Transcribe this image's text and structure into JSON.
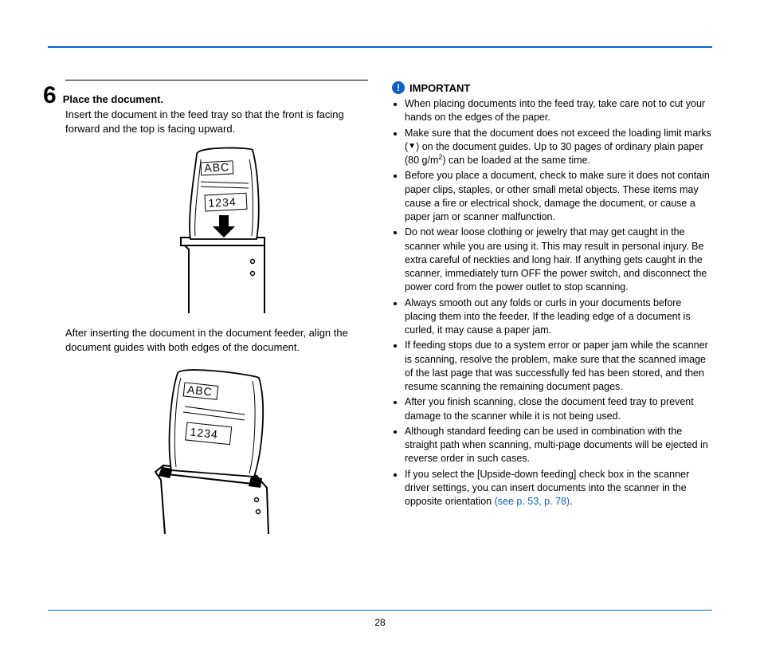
{
  "page_number": "28",
  "step": {
    "number": "6",
    "heading": "Place the document.",
    "body": "Insert the document in the feed tray so that the front is facing forward and the top is facing upward.",
    "caption2": "After inserting the document in the document feeder, align the document guides with both edges of the document."
  },
  "illus_text": {
    "abc": "ABC",
    "num": "1234"
  },
  "important": {
    "label": "IMPORTANT",
    "items": [
      "When placing documents into the feed tray, take care not to cut your hands on the edges of the paper.",
      "Make sure that the document does not exceed the loading limit marks (▼) on the document guides. Up to 30 pages of ordinary plain paper (80 g/m²) can be loaded at the same time.",
      "Before you place a document, check to make sure it does not contain paper clips, staples, or other small metal objects. These items may cause a fire or electrical shock, damage the document, or cause a paper jam or scanner malfunction.",
      "Do not wear loose clothing or jewelry that may get caught in the scanner while you are using it. This may result in personal injury. Be extra careful of neckties and long hair. If anything gets caught in the scanner, immediately turn OFF the power switch, and disconnect the power cord from the power outlet to stop scanning.",
      "Always smooth out any folds or curls in your documents before placing them into the feeder. If the leading edge of a document is curled, it may cause a paper jam.",
      "If feeding stops due to a system error or paper jam while the scanner is scanning, resolve the problem, make sure that the scanned image of the last page that was successfully fed has been stored, and then resume scanning the remaining document pages.",
      "After you finish scanning, close the document feed tray to prevent damage to the scanner while it is not being used.",
      "Although standard feeding can be used in combination with the straight path when scanning, multi-page documents will be ejected in reverse order in such cases.",
      "If you select the [Upside-down feeding] check box in the scanner driver settings, you can insert documents into the scanner in the opposite orientation (see p. 53, p. 78)."
    ],
    "link_text": "(see p. 53, p. 78)"
  }
}
